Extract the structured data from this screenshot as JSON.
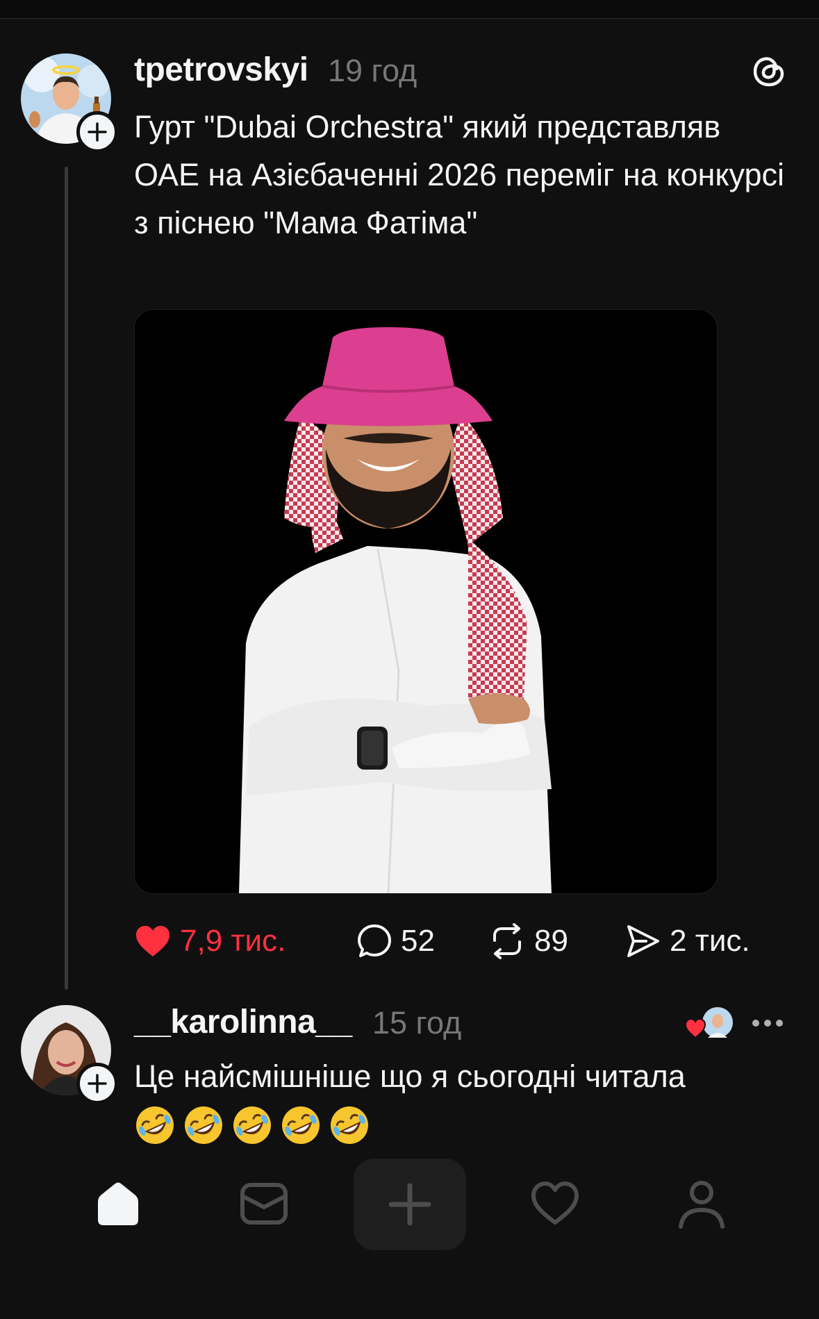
{
  "post": {
    "username": "tpetrovskyi",
    "time": "19 год",
    "text": "Гурт \"Dubai Orchestra\" який представляв ОАЕ на Азієбаченні 2026 переміг на конкурсі з піснею \"Мама Фатіма\"",
    "actions": {
      "likes": "7,9 тис.",
      "comments": "52",
      "reposts": "89",
      "shares": "2 тис."
    }
  },
  "reply": {
    "username": "__karolinna__",
    "time": "15 год",
    "text": "Це найсмішніше що я сьогодні читала"
  },
  "colors": {
    "background": "#101010",
    "like_red": "#ff3040",
    "muted": "#777777",
    "hat_pink": "#dc3f8f"
  },
  "icons": [
    "threads-logo-icon",
    "plus-icon",
    "heart-filled-icon",
    "comment-icon",
    "repost-icon",
    "share-icon",
    "more-icon",
    "home-icon",
    "inbox-icon",
    "compose-plus-icon",
    "heart-outline-icon",
    "profile-icon",
    "rofl-emoji"
  ]
}
